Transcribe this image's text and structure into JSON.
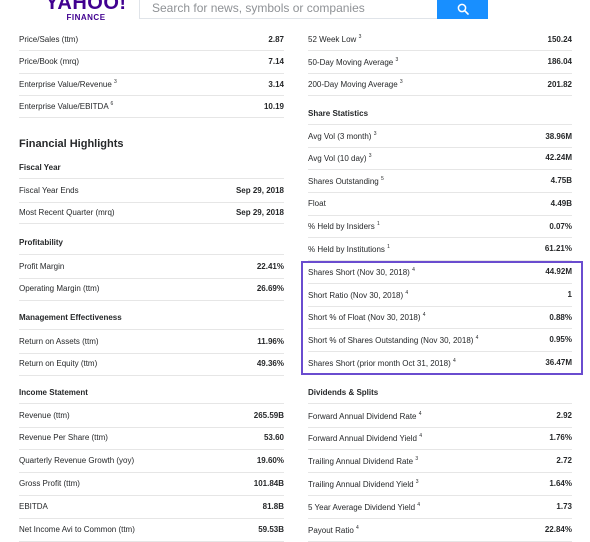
{
  "header": {
    "logo_main": "YAHOO!",
    "logo_sub": "FINANCE",
    "search_placeholder": "Search for news, symbols or companies"
  },
  "colors": {
    "accent": "#188fff",
    "highlight": "#6a4ccf",
    "brand": "#400090"
  },
  "left": {
    "top_rows": [
      {
        "label": "Price/Sales (ttm)",
        "sup": "",
        "value": "2.87"
      },
      {
        "label": "Price/Book (mrq)",
        "sup": "",
        "value": "7.14"
      },
      {
        "label": "Enterprise Value/Revenue",
        "sup": "3",
        "value": "3.14"
      },
      {
        "label": "Enterprise Value/EBITDA",
        "sup": "6",
        "value": "10.19"
      }
    ],
    "financial_highlights": "Financial Highlights",
    "fiscal_year": {
      "title": "Fiscal Year",
      "rows": [
        {
          "label": "Fiscal Year Ends",
          "sup": "",
          "value": "Sep 29, 2018"
        },
        {
          "label": "Most Recent Quarter (mrq)",
          "sup": "",
          "value": "Sep 29, 2018"
        }
      ]
    },
    "profitability": {
      "title": "Profitability",
      "rows": [
        {
          "label": "Profit Margin",
          "sup": "",
          "value": "22.41%"
        },
        {
          "label": "Operating Margin (ttm)",
          "sup": "",
          "value": "26.69%"
        }
      ]
    },
    "management": {
      "title": "Management Effectiveness",
      "rows": [
        {
          "label": "Return on Assets (ttm)",
          "sup": "",
          "value": "11.96%"
        },
        {
          "label": "Return on Equity (ttm)",
          "sup": "",
          "value": "49.36%"
        }
      ]
    },
    "income": {
      "title": "Income Statement",
      "rows": [
        {
          "label": "Revenue (ttm)",
          "sup": "",
          "value": "265.59B"
        },
        {
          "label": "Revenue Per Share (ttm)",
          "sup": "",
          "value": "53.60"
        },
        {
          "label": "Quarterly Revenue Growth (yoy)",
          "sup": "",
          "value": "19.60%"
        },
        {
          "label": "Gross Profit (ttm)",
          "sup": "",
          "value": "101.84B"
        },
        {
          "label": "EBITDA",
          "sup": "",
          "value": "81.8B"
        },
        {
          "label": "Net Income Avi to Common (ttm)",
          "sup": "",
          "value": "59.53B"
        }
      ]
    }
  },
  "right": {
    "top_rows": [
      {
        "label": "52 Week Low",
        "sup": "3",
        "value": "150.24"
      },
      {
        "label": "50-Day Moving Average",
        "sup": "3",
        "value": "186.04"
      },
      {
        "label": "200-Day Moving Average",
        "sup": "3",
        "value": "201.82"
      }
    ],
    "share_statistics": {
      "title": "Share Statistics",
      "rows": [
        {
          "label": "Avg Vol (3 month)",
          "sup": "3",
          "value": "38.96M"
        },
        {
          "label": "Avg Vol (10 day)",
          "sup": "3",
          "value": "42.24M"
        },
        {
          "label": "Shares Outstanding",
          "sup": "5",
          "value": "4.75B"
        },
        {
          "label": "Float",
          "sup": "",
          "value": "4.49B"
        },
        {
          "label": "% Held by Insiders",
          "sup": "1",
          "value": "0.07%"
        },
        {
          "label": "% Held by Institutions",
          "sup": "1",
          "value": "61.21%"
        },
        {
          "label": "Shares Short (Nov 30, 2018)",
          "sup": "4",
          "value": "44.92M"
        },
        {
          "label": "Short Ratio (Nov 30, 2018)",
          "sup": "4",
          "value": "1"
        },
        {
          "label": "Short % of Float (Nov 30, 2018)",
          "sup": "4",
          "value": "0.88%"
        },
        {
          "label": "Short % of Shares Outstanding (Nov 30, 2018)",
          "sup": "4",
          "value": "0.95%"
        },
        {
          "label": "Shares Short (prior month Oct 31, 2018)",
          "sup": "4",
          "value": "36.47M"
        }
      ]
    },
    "dividends": {
      "title": "Dividends & Splits",
      "rows": [
        {
          "label": "Forward Annual Dividend Rate",
          "sup": "4",
          "value": "2.92"
        },
        {
          "label": "Forward Annual Dividend Yield",
          "sup": "4",
          "value": "1.76%"
        },
        {
          "label": "Trailing Annual Dividend Rate",
          "sup": "3",
          "value": "2.72"
        },
        {
          "label": "Trailing Annual Dividend Yield",
          "sup": "3",
          "value": "1.64%"
        },
        {
          "label": "5 Year Average Dividend Yield",
          "sup": "4",
          "value": "1.73"
        },
        {
          "label": "Payout Ratio",
          "sup": "4",
          "value": "22.84%"
        }
      ]
    }
  }
}
